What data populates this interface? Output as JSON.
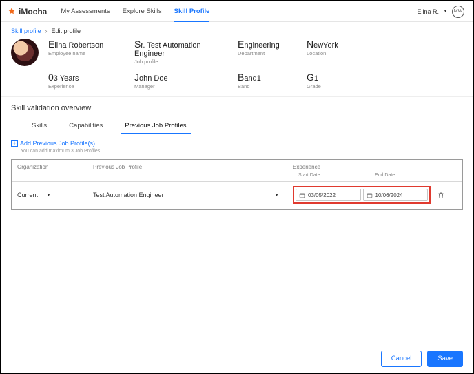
{
  "brand": "iMocha",
  "nav": {
    "items": [
      "My Assessments",
      "Explore Skills",
      "Skill Profile"
    ],
    "activeIndex": 2
  },
  "user": {
    "name": "Elina R.",
    "initials": "MW"
  },
  "breadcrumb": {
    "parent": "Skill profile",
    "current": "Edit profile"
  },
  "profile": {
    "fields": [
      {
        "value": "Elina Robertson",
        "label": "Employee name"
      },
      {
        "value": "Sr. Test Automation Engineer",
        "label": "Job profile"
      },
      {
        "value": "Engineering",
        "label": "Department"
      },
      {
        "value": "NewYork",
        "label": "Location"
      },
      {
        "value": "03 Years",
        "label": "Experience"
      },
      {
        "value": "John Doe",
        "label": "Manager"
      },
      {
        "value": "Band1",
        "label": "Band"
      },
      {
        "value": "G1",
        "label": "Grade"
      }
    ]
  },
  "sectionTitle": "Skill validation overview",
  "tabs": {
    "items": [
      "Skills",
      "Capabilities",
      "Previous Job Profiles"
    ],
    "activeIndex": 2
  },
  "add": {
    "label": "Add Previous Job Profile(s)",
    "hint": "You can add maximum 3 Job Profiles"
  },
  "table": {
    "headers": {
      "org": "Organization",
      "job": "Previous Job Profile",
      "exp": "Experience",
      "start": "Start Date",
      "end": "End Date"
    },
    "rows": [
      {
        "org": "Current",
        "job": "Test Automation Engineer",
        "start": "03/05/2022",
        "end": "10/06/2024"
      }
    ]
  },
  "footer": {
    "cancel": "Cancel",
    "save": "Save"
  }
}
